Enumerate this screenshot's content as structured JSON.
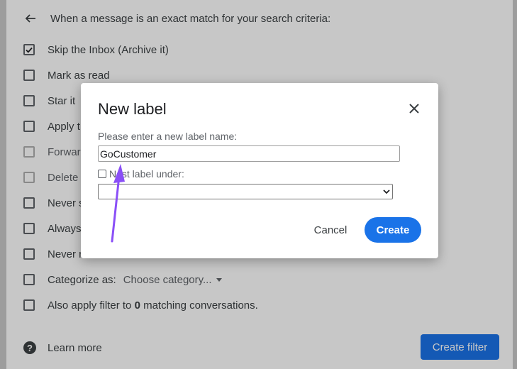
{
  "filter_panel": {
    "header": "When a message is an exact match for your search criteria:",
    "options": [
      {
        "label": "Skip the Inbox (Archive it)",
        "checked": true
      },
      {
        "label": "Mark as read",
        "checked": false
      },
      {
        "label": "Star it",
        "checked": false
      },
      {
        "label": "Apply t",
        "checked": false
      },
      {
        "label": "Forwar",
        "checked": false
      },
      {
        "label": "Delete i",
        "checked": false
      },
      {
        "label": "Never s",
        "checked": false
      },
      {
        "label": "Always",
        "checked": false
      },
      {
        "label": "Never m",
        "checked": false
      }
    ],
    "categorize_label": "Categorize as:",
    "categorize_value": "Choose category...",
    "also_apply_prefix": "Also apply filter to ",
    "also_apply_count": "0",
    "also_apply_suffix": " matching conversations.",
    "learn_more": "Learn more",
    "create_filter": "Create filter",
    "help_glyph": "?"
  },
  "dialog": {
    "title": "New label",
    "prompt": "Please enter a new label name:",
    "label_value": "GoCustomer",
    "nest_label": "Nest label under:",
    "nest_checked": false,
    "parent_value": "",
    "cancel": "Cancel",
    "create": "Create"
  },
  "colors": {
    "primary": "#1a73e8",
    "annotation_arrow": "#8a4ff7"
  }
}
